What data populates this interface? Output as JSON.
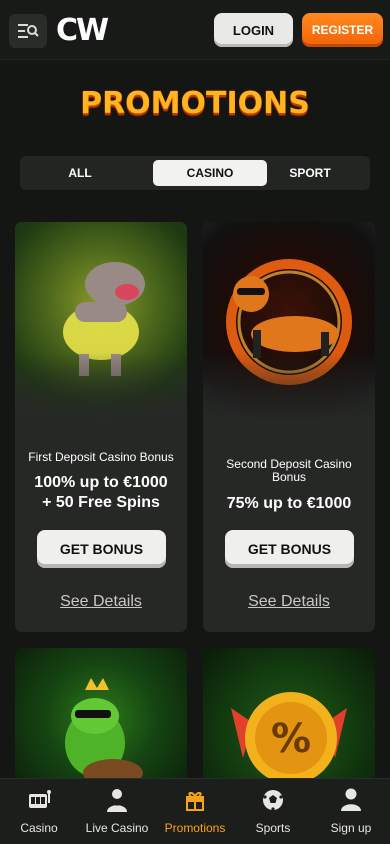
{
  "header": {
    "logo_text": "CW",
    "login_label": "LOGIN",
    "register_label": "REGISTER"
  },
  "page_title": "PROMOTIONS",
  "tabs": [
    {
      "label": "ALL"
    },
    {
      "label": "CASINO",
      "active": true
    },
    {
      "label": "SPORT"
    }
  ],
  "promotions": [
    {
      "title": "First Deposit Casino Bonus",
      "offer_line1": "100% up to €1000",
      "offer_line2": "+ 50 Free Spins",
      "button_label": "GET BONUS",
      "details_label": "See Details",
      "art_icon": "hippo-illustration"
    },
    {
      "title_line1": "Second Deposit Casino",
      "title_line2": "Bonus",
      "offer_line1": "75% up to €1000",
      "button_label": "GET BONUS",
      "details_label": "See Details",
      "art_icon": "tiger-illustration"
    }
  ],
  "promo_art_more": [
    {
      "art_icon": "frog-king-illustration"
    },
    {
      "art_icon": "percent-coin-illustration"
    }
  ],
  "bottom_nav": [
    {
      "label": "Casino",
      "icon": "slot-machine-icon"
    },
    {
      "label": "Live Casino",
      "icon": "dealer-icon"
    },
    {
      "label": "Promotions",
      "icon": "gift-icon",
      "active": true
    },
    {
      "label": "Sports",
      "icon": "soccer-ball-icon"
    },
    {
      "label": "Sign up",
      "icon": "user-icon"
    }
  ],
  "colors": {
    "accent_orange": "#f7a21b",
    "register_orange": "#f2620a",
    "background": "#141614"
  }
}
